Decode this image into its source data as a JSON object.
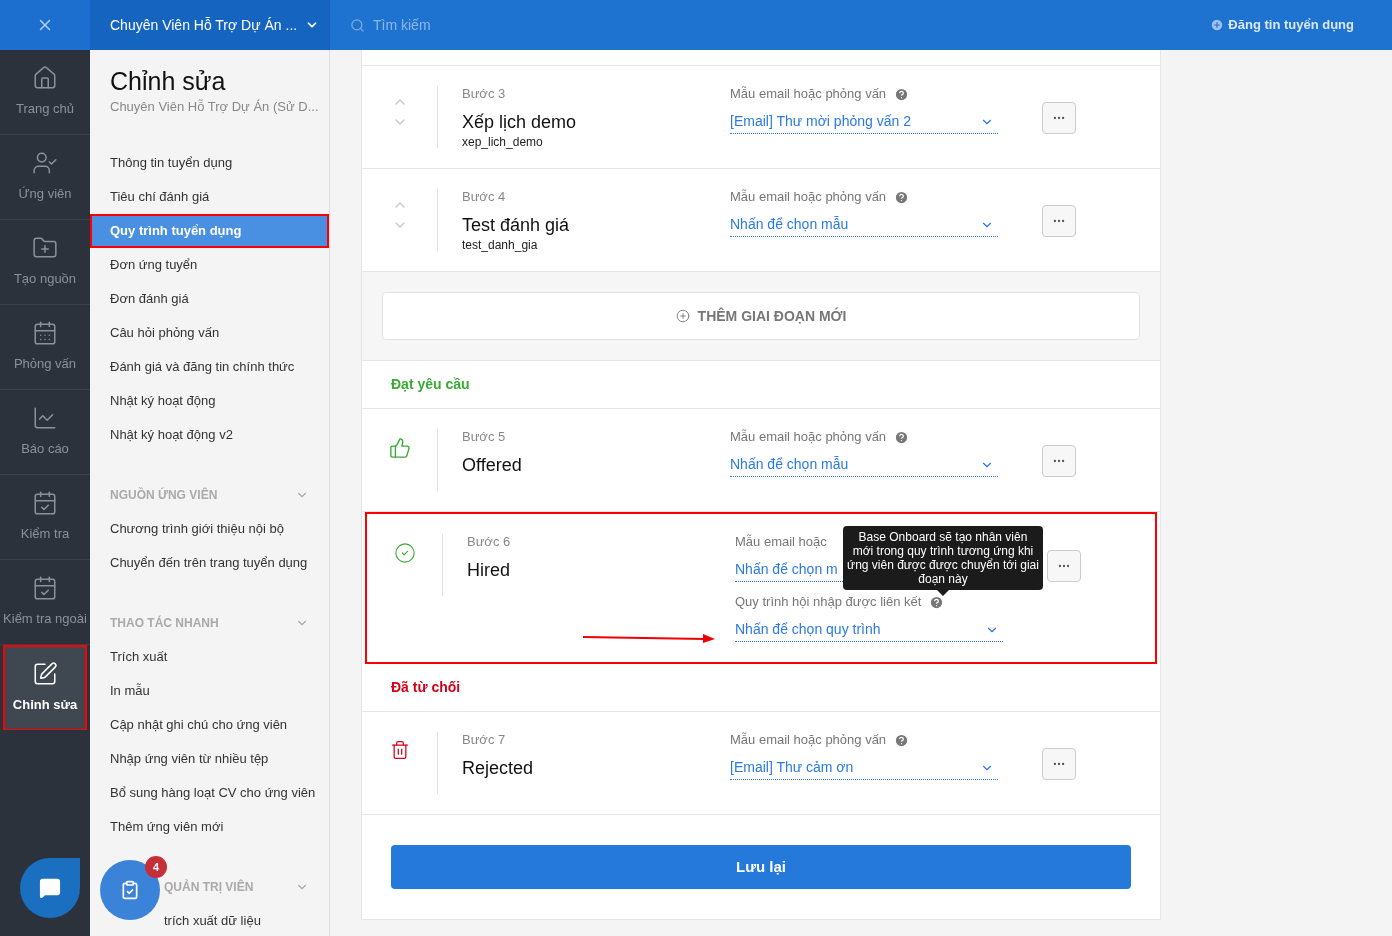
{
  "topbar": {
    "job_title": "Chuyên Viên Hỗ Trợ Dự Án ...",
    "search_placeholder": "Tìm kiếm",
    "post_job": "Đăng tin tuyển dụng"
  },
  "rail": [
    {
      "kind": "home",
      "label": "Trang chủ",
      "selected": false,
      "highlighted": false
    },
    {
      "kind": "candidate",
      "label": "Ứng viên",
      "selected": false,
      "highlighted": false
    },
    {
      "kind": "source",
      "label": "Tạo nguồn",
      "selected": false,
      "highlighted": false
    },
    {
      "kind": "interview",
      "label": "Phỏng vấn",
      "selected": false,
      "highlighted": false
    },
    {
      "kind": "report",
      "label": "Báo cáo",
      "selected": false,
      "highlighted": false
    },
    {
      "kind": "test",
      "label": "Kiểm tra",
      "selected": false,
      "highlighted": false
    },
    {
      "kind": "test",
      "label": "Kiểm tra ngoài",
      "selected": false,
      "highlighted": false
    },
    {
      "kind": "edit",
      "label": "Chỉnh sửa",
      "selected": true,
      "highlighted": true
    }
  ],
  "sidebar": {
    "title": "Chỉnh sửa",
    "subtitle": "Chuyên Viên Hỗ Trợ Dự Án (Sử D...",
    "items": [
      {
        "label": "Thông tin tuyển dụng",
        "selected": false,
        "highlighted": false
      },
      {
        "label": "Tiêu chí đánh giá",
        "selected": false,
        "highlighted": false
      },
      {
        "label": "Quy trình tuyển dụng",
        "selected": true,
        "highlighted": true
      },
      {
        "label": "Đơn ứng tuyển",
        "selected": false,
        "highlighted": false
      },
      {
        "label": "Đơn đánh giá",
        "selected": false,
        "highlighted": false
      },
      {
        "label": "Câu hỏi phỏng vấn",
        "selected": false,
        "highlighted": false
      },
      {
        "label": "Đánh giá và đăng tin chính thức",
        "selected": false,
        "highlighted": false
      },
      {
        "label": "Nhật ký hoạt động",
        "selected": false,
        "highlighted": false
      },
      {
        "label": "Nhật ký hoạt động v2",
        "selected": false,
        "highlighted": false
      }
    ],
    "groups": [
      {
        "title": "NGUỒN ỨNG VIÊN",
        "items": [
          "Chương trình giới thiệu nội bộ",
          "Chuyển đến trên trang tuyển dụng"
        ]
      },
      {
        "title": "THAO TÁC NHANH",
        "items": [
          "Trích xuất",
          "In mẫu",
          "Cập nhật ghi chú cho ứng viên",
          "Nhập ứng viên từ nhiều tệp",
          "Bổ sung hàng loạt CV cho ứng viên",
          "Thêm ứng viên mới"
        ]
      },
      {
        "title": "QUẢN TRỊ VIÊN",
        "items": [
          "trích xuất dữ liệu"
        ]
      }
    ]
  },
  "pipeline": [
    {
      "kind": "reorder",
      "step": "Bước 3",
      "name": "Xếp lịch demo",
      "code": "xep_lich_demo",
      "highlighted": false,
      "fields": [
        {
          "kind": "full",
          "label": "Mẫu email hoặc phỏng vấn",
          "value": "[Email] Thư mời phỏng vấn 2"
        }
      ]
    },
    {
      "kind": "reorder",
      "step": "Bước 4",
      "name": "Test đánh giá",
      "code": "test_danh_gia",
      "highlighted": false,
      "fields": [
        {
          "kind": "full",
          "label": "Mẫu email hoặc phỏng vấn",
          "value": "Nhấn để chọn mẫu"
        }
      ]
    }
  ],
  "add_stage": "THÊM GIAI ĐOẠN MỚI",
  "outcomes": [
    {
      "title": "Đạt yêu cầu",
      "color": "#3aaa35",
      "stages": [
        {
          "kind": "offered",
          "step": "Bước 5",
          "name": "Offered",
          "highlighted": false,
          "fields": [
            {
              "kind": "full",
              "label": "Mẫu email hoặc phỏng vấn",
              "value": "Nhấn để chọn mẫu"
            }
          ]
        },
        {
          "kind": "hired",
          "step": "Bước 6",
          "name": "Hired",
          "highlighted": true,
          "arrow": true,
          "tooltip": "Base Onboard sẽ tạo nhân viên mới trong quy trình tương ứng khi ứng viên được được chuyển tới giai đoạn này",
          "fields": [
            {
              "kind": "covered",
              "label": "Mẫu email hoặc",
              "value": "Nhấn để chọn m"
            },
            {
              "kind": "full",
              "label": "Quy trình hội nhập được liên kết",
              "value": "Nhấn để chọn quy trình"
            }
          ]
        }
      ]
    },
    {
      "title": "Đã từ chối",
      "color": "#d0021b",
      "stages": [
        {
          "kind": "rejected",
          "step": "Bước 7",
          "name": "Rejected",
          "highlighted": false,
          "fields": [
            {
              "kind": "full",
              "label": "Mẫu email hoặc phỏng vấn",
              "value": "[Email] Thư cảm ơn"
            }
          ]
        }
      ]
    }
  ],
  "save_button": "Lưu lại",
  "task_badge": "4"
}
